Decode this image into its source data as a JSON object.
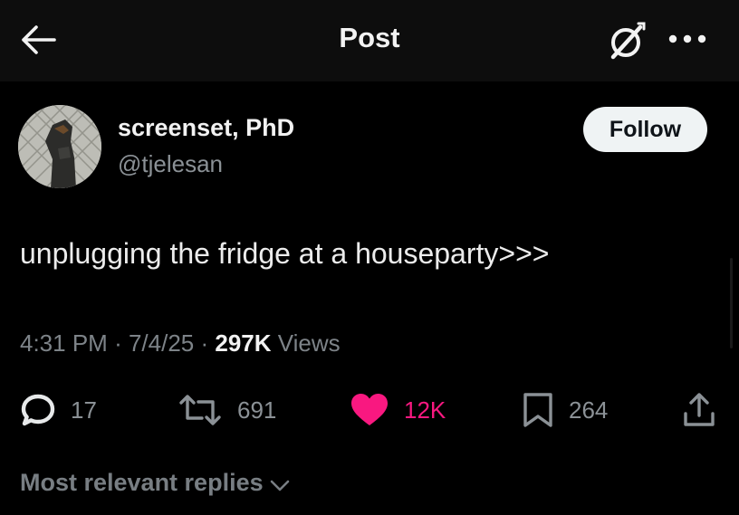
{
  "header": {
    "title": "Post"
  },
  "author": {
    "name": "screenset, PhD",
    "handle": "@tjelesan",
    "follow_label": "Follow"
  },
  "post": {
    "text": "unplugging the fridge at a houseparty>>>",
    "time": "4:31 PM",
    "date": "7/4/25",
    "views_count": "297K",
    "views_label": "Views"
  },
  "actions": {
    "replies": "17",
    "reposts": "691",
    "likes": "12K",
    "bookmarks": "264"
  },
  "replies_filter": {
    "label": "Most relevant replies"
  },
  "colors": {
    "like": "#f91880",
    "muted": "#8b9196",
    "background": "#000000"
  },
  "icons": [
    "back-arrow-icon",
    "grok-icon",
    "more-icon",
    "reply-icon",
    "repost-icon",
    "heart-icon",
    "bookmark-icon",
    "share-icon",
    "chevron-down-icon"
  ]
}
